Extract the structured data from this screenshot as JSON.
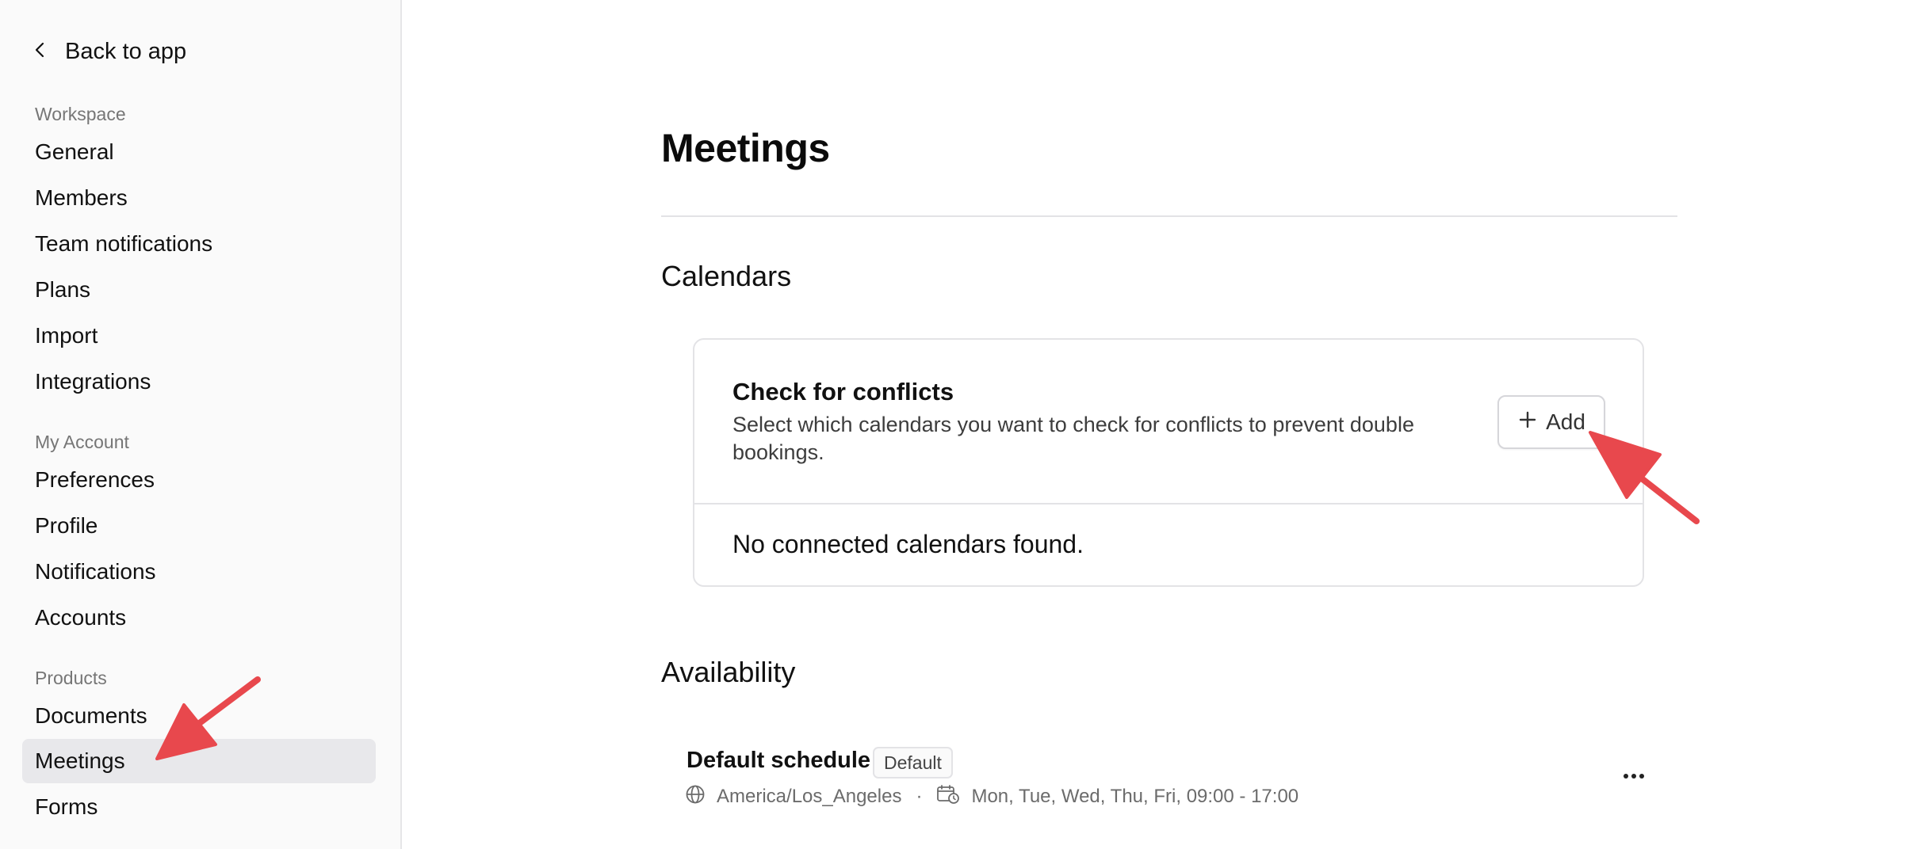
{
  "sidebar": {
    "back_label": "Back to app",
    "sections": [
      {
        "label": "Workspace",
        "items": [
          "General",
          "Members",
          "Team notifications",
          "Plans",
          "Import",
          "Integrations"
        ]
      },
      {
        "label": "My Account",
        "items": [
          "Preferences",
          "Profile",
          "Notifications",
          "Accounts"
        ]
      },
      {
        "label": "Products",
        "items": [
          "Documents",
          "Meetings",
          "Forms"
        ]
      }
    ],
    "active_item": "Meetings"
  },
  "main": {
    "title": "Meetings",
    "calendars": {
      "heading": "Calendars",
      "card_title": "Check for conflicts",
      "card_description": "Select which calendars you want to check for conflicts to prevent double bookings.",
      "add_label": "Add",
      "empty_text": "No connected calendars found."
    },
    "availability": {
      "heading": "Availability",
      "schedule_name": "Default schedule",
      "badge": "Default",
      "timezone": "America/Los_Angeles",
      "separator": "·",
      "hours": "Mon, Tue, Wed, Thu, Fri, 09:00 - 17:00"
    }
  },
  "icons": {
    "back": "chevron-left-icon",
    "add": "plus-icon",
    "timezone": "globe-icon",
    "hours": "calendar-clock-icon",
    "more": "more-horizontal-icon"
  },
  "colors": {
    "annotation_arrow": "#e8484d",
    "active_bg": "#e8e8eb"
  }
}
